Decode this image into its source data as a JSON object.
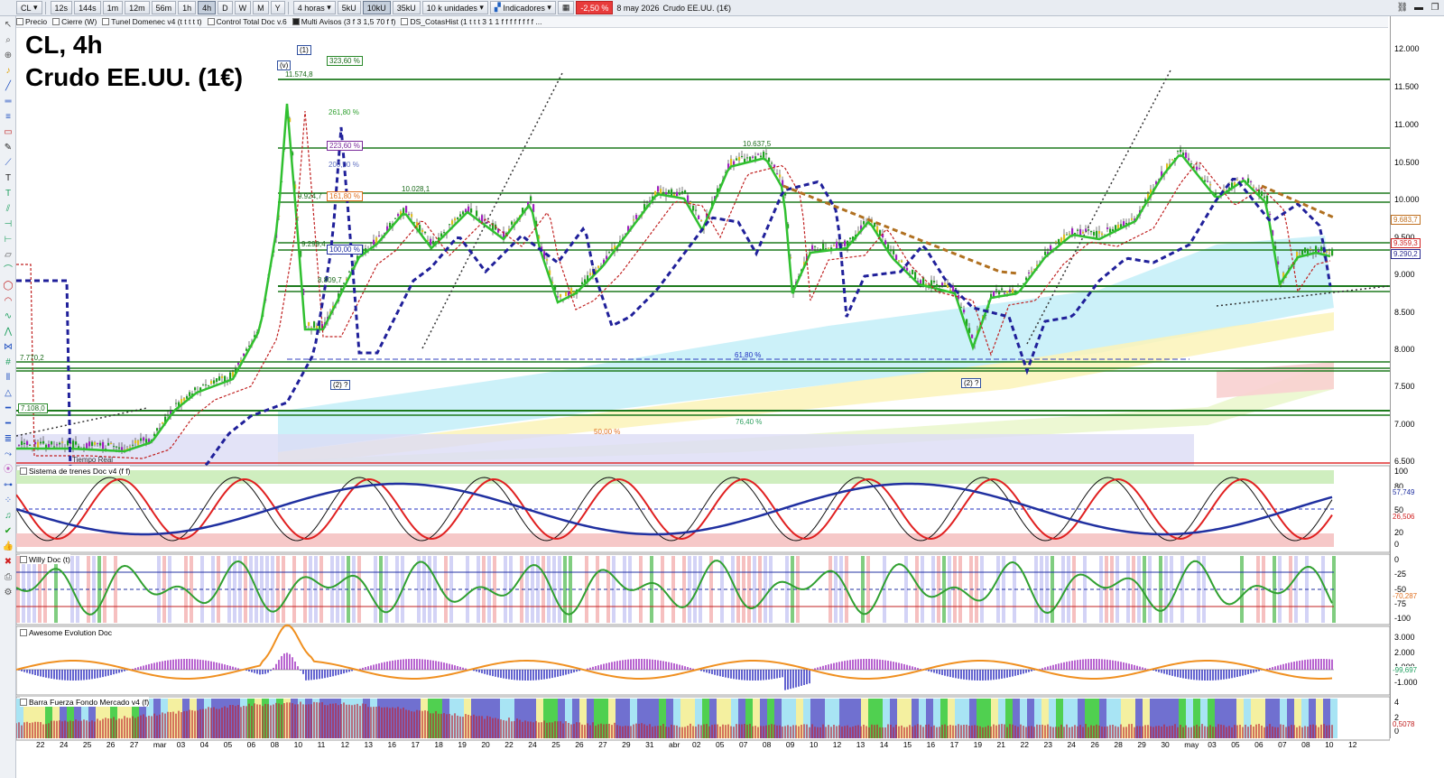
{
  "toolbar": {
    "symbol": "CL",
    "timeframes": [
      "12s",
      "144s",
      "1m",
      "12m",
      "56m",
      "1h",
      "4h",
      "D",
      "W",
      "M",
      "Y"
    ],
    "active_timeframe": "4h",
    "period_select": "4 horas",
    "volumes": [
      "5kU",
      "10kU",
      "35kU"
    ],
    "active_volume": "10kU",
    "units_select": "10 k unidades",
    "indicators_label": "Indicadores",
    "change_badge": "-2,50 %",
    "datetime": "8 may 2026",
    "instrument": "Crudo EE.UU. (1€)"
  },
  "tabs": [
    "Precio",
    "Cierre (W)",
    "Tunel Domenec v4 (t t t t t)",
    "Control Total Doc v.6",
    "Multi Avisos (3 f 3 1,5 70 f f)",
    "DS_CotasHist (1 t t t 3 1 1 f f f f f f f f ..."
  ],
  "tab_checked": [
    false,
    false,
    false,
    false,
    true,
    false
  ],
  "title": {
    "line1": "CL, 4h",
    "line2": "Crudo EE.UU. (1€)"
  },
  "price_axis": [
    "12.000",
    "11.500",
    "11.000",
    "10.500",
    "10.000",
    "9.500",
    "9.000",
    "8.500",
    "8.000",
    "7.500",
    "7.000",
    "6.500"
  ],
  "price_tags": [
    {
      "text": "9.683,7",
      "color": "#c07020"
    },
    {
      "text": "9.359,3",
      "color": "#d02020"
    },
    {
      "text": "9.290,2",
      "color": "#2a2a90"
    }
  ],
  "annotations": {
    "level_high": "11.574,8",
    "level_10637": "10.637,5",
    "level_10028": "10.028,1",
    "level_9924": "9.924,7",
    "level_9299": "9.299,4",
    "level_8809": "8.809,7",
    "level_7770": "7.770,2",
    "level_7108": "7.108,0",
    "fib_323": "323,60 %",
    "fib_261": "261,80 %",
    "fib_223": "223,60 %",
    "fib_200": "200,00 %",
    "fib_161": "161,80 %",
    "fib_100": "100,00 %",
    "fib_61": "61,80 %",
    "fib_50": "50,00 %",
    "fib_76": "76,40 %",
    "wave_1": "(1)",
    "wave_v": "(v)",
    "wave_2a": "(2) ?",
    "wave_2b": "(2) ?",
    "realtime": "Tiempo Real"
  },
  "panels": {
    "trenes": {
      "title": "Sistema de trenes Doc v4 (f f)",
      "axis": [
        "100",
        "80",
        "50",
        "20",
        "0"
      ],
      "tags": [
        "57,749",
        "26,506"
      ]
    },
    "willy": {
      "title": "Willy Doc (t)",
      "axis": [
        "0",
        "-25",
        "-50",
        "-75",
        "-100"
      ],
      "tags": [
        "-70,287"
      ]
    },
    "awesome": {
      "title": "Awesome Evolution Doc",
      "axis": [
        "3.000",
        "2.000",
        "1.000",
        "0",
        "-1.000"
      ],
      "tags": [
        "-99,697"
      ]
    },
    "barra": {
      "title": "Barra Fuerza Fondo Mercado v4 (f)",
      "axis": [
        "4",
        "2",
        "0"
      ],
      "tags": [
        "0,5078"
      ]
    }
  },
  "dates": [
    "22",
    "24",
    "25",
    "26",
    "27",
    "mar",
    "03",
    "04",
    "05",
    "06",
    "08",
    "10",
    "11",
    "12",
    "13",
    "16",
    "17",
    "18",
    "19",
    "20",
    "22",
    "24",
    "25",
    "26",
    "27",
    "29",
    "31",
    "abr",
    "02",
    "05",
    "07",
    "08",
    "09",
    "10",
    "12",
    "13",
    "14",
    "15",
    "16",
    "17",
    "19",
    "21",
    "22",
    "23",
    "24",
    "26",
    "28",
    "29",
    "30",
    "may",
    "03",
    "05",
    "06",
    "07",
    "08",
    "10",
    "12"
  ]
}
